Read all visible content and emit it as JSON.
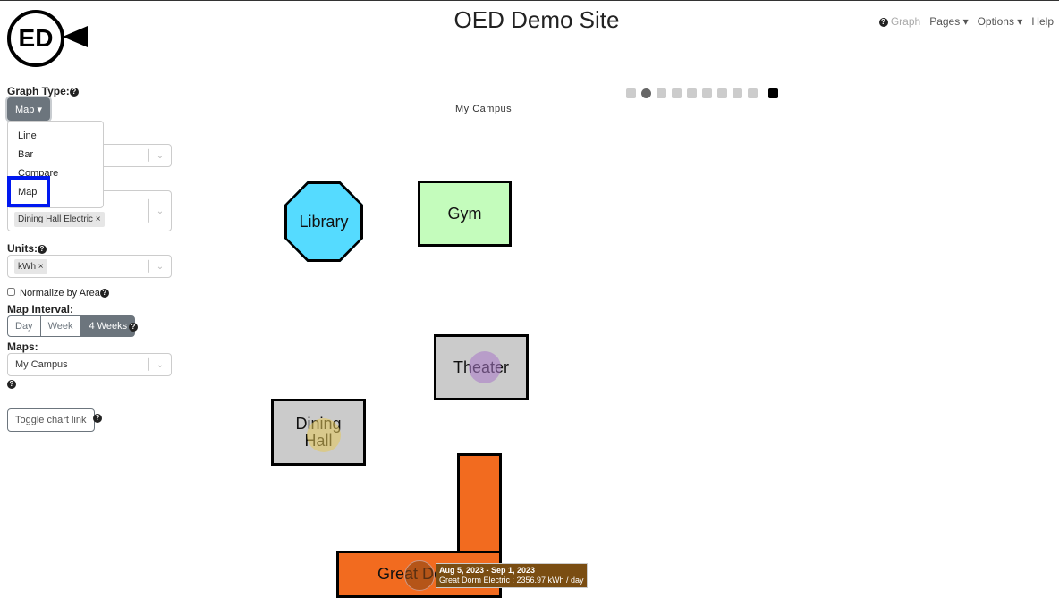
{
  "header": {
    "title": "OED Demo Site",
    "logo": "ED",
    "nav": [
      {
        "label": "Graph",
        "icon": "help-icon"
      },
      {
        "label": "Pages ▾"
      },
      {
        "label": "Options ▾"
      },
      {
        "label": "Help"
      }
    ]
  },
  "sidebar": {
    "graph_type_label": "Graph Type:",
    "graph_type_value": "Map ▾",
    "graph_type_options": [
      "Line",
      "Bar",
      "Compare",
      "Map"
    ],
    "meters_chip": "Dining Hall Electric",
    "units_label": "Units:",
    "units_chip": "kWh",
    "normalize_label": "Normalize by Area",
    "map_interval_label": "Map Interval:",
    "intervals": [
      "Day",
      "Week",
      "4 Weeks"
    ],
    "selected_interval": "4 Weeks",
    "maps_label": "Maps:",
    "maps_value": "My Campus",
    "toggle_chart_link": "Toggle chart link"
  },
  "map": {
    "title": "My Campus",
    "buildings": {
      "library": "Library",
      "gym": "Gym",
      "theater": "Theater",
      "dining": "Dining Hall",
      "dorm": "Great Dorm"
    },
    "tooltip": {
      "line1": "Aug 5, 2023 - Sep 1, 2023",
      "line2": "Great Dorm Electric : 2356.97 kWh / day"
    },
    "colors": {
      "library": "#55dbff",
      "gym": "#c4fcbc",
      "grey": "#cbcbcb",
      "dorm": "#f26b1f",
      "tooltip": "#7a4d12"
    }
  }
}
